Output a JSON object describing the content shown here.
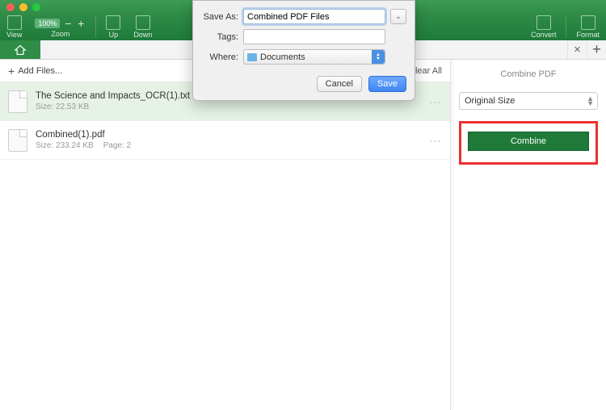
{
  "titlebar": {},
  "toolbar": {
    "view": "View",
    "zoom_label": "Zoom",
    "zoom_value": "100%",
    "up": "Up",
    "down": "Down",
    "convert": "Convert",
    "format": "Format"
  },
  "left": {
    "add_files": "Add Files...",
    "clear_all": "Clear All",
    "files": [
      {
        "name": "The Science and Impacts_OCR(1).txt",
        "size": "Size: 22.53 KB",
        "page": ""
      },
      {
        "name": "Combined(1).pdf",
        "size": "Size: 233.24 KB",
        "page": "Page: 2"
      }
    ]
  },
  "right": {
    "title": "Combine PDF",
    "size_select": "Original Size",
    "combine": "Combine"
  },
  "dialog": {
    "save_as_label": "Save As:",
    "save_as_value": "Combined PDF Files",
    "tags_label": "Tags:",
    "tags_value": "",
    "where_label": "Where:",
    "where_value": "Documents",
    "cancel": "Cancel",
    "save": "Save"
  }
}
